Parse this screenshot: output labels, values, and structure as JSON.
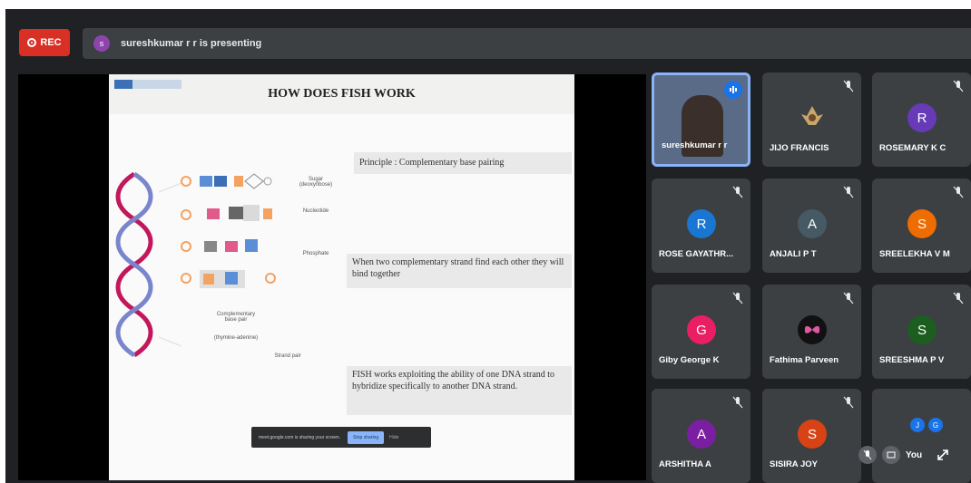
{
  "topbar": {
    "rec_label": "REC",
    "presenter_initial": "s",
    "presenting_text": "sureshkumar r r is presenting"
  },
  "slide": {
    "title": "HOW DOES FISH WORK",
    "principle": "Principle : Complementary base pairing",
    "box2": "When two complementary strand find each other they will bind together",
    "box3": "FISH  works exploiting the ability of one DNA strand to hybridize specifically to another DNA strand.",
    "captions": {
      "sugar": "Sugar (deoxyribose)",
      "nucleotide": "Nucleotide",
      "phosphate": "Phosphate",
      "base_pair": "Complementary base pair",
      "base_pair_sub": "(thymine-adenine)",
      "strand": "Strand pair"
    }
  },
  "sharebar": {
    "text": "meet.google.com is sharing your screen.",
    "stop_label": "Stop sharing",
    "hide_label": "Hide"
  },
  "participants": [
    {
      "name": "sureshkumar r r",
      "initial": "",
      "color": "#5a6b87",
      "self": true
    },
    {
      "name": "JIJO FRANCIS",
      "initial": "",
      "color": "#3c4043"
    },
    {
      "name": "ROSEMARY K C",
      "initial": "R",
      "color": "#673ab7"
    },
    {
      "name": "ROSE GAYATHR...",
      "initial": "R",
      "color": "#1976d2"
    },
    {
      "name": "ANJALI P T",
      "initial": "A",
      "color": "#455a64"
    },
    {
      "name": "SREELEKHA V M",
      "initial": "S",
      "color": "#ef6c00"
    },
    {
      "name": "Giby George K",
      "initial": "G",
      "color": "#e91e63"
    },
    {
      "name": "Fathima Parveen",
      "initial": "",
      "color": "#111111"
    },
    {
      "name": "SREESHMA P V",
      "initial": "S",
      "color": "#1b5e20"
    },
    {
      "name": "ARSHITHA A",
      "initial": "A",
      "color": "#7b1fa2"
    },
    {
      "name": "SISIRA JOY",
      "initial": "S",
      "color": "#d84315"
    }
  ],
  "others_tile": {
    "initials": [
      "J",
      "G"
    ]
  },
  "controls": {
    "you_label": "You"
  }
}
